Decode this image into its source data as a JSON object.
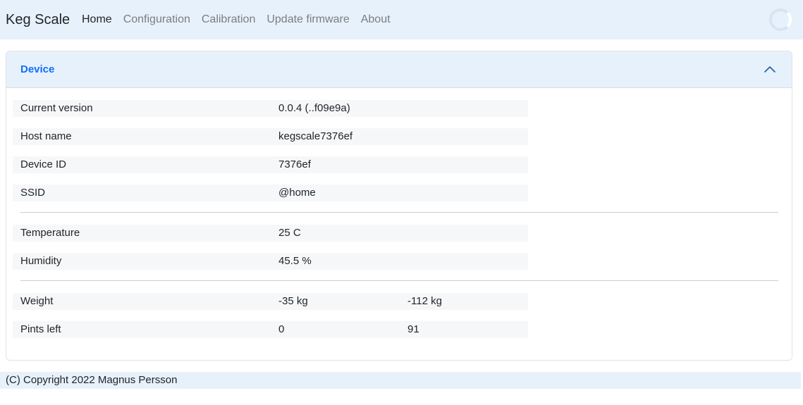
{
  "navbar": {
    "brand": "Keg Scale",
    "links": [
      "Home",
      "Configuration",
      "Calibration",
      "Update firmware",
      "About"
    ],
    "active": "Home"
  },
  "device_card": {
    "title": "Device",
    "rows": [
      {
        "label": "Current version",
        "value": "0.0.4 (..f09e9a)"
      },
      {
        "label": "Host name",
        "value": "kegscale7376ef"
      },
      {
        "label": "Device ID",
        "value": "7376ef"
      },
      {
        "label": "SSID",
        "value": "@home"
      },
      {
        "label": "Temperature",
        "value": "25 C"
      },
      {
        "label": "Humidity",
        "value": "45.5 %"
      },
      {
        "label": "Weight",
        "value": "-35 kg",
        "value2": "-112 kg"
      },
      {
        "label": "Pints left",
        "value": "0",
        "value2": "91"
      }
    ]
  },
  "footer": {
    "text": "(C) Copyright 2022 Magnus Persson"
  },
  "colors": {
    "navbar_bg": "#e7f1fb",
    "accent": "#0d6efd"
  }
}
